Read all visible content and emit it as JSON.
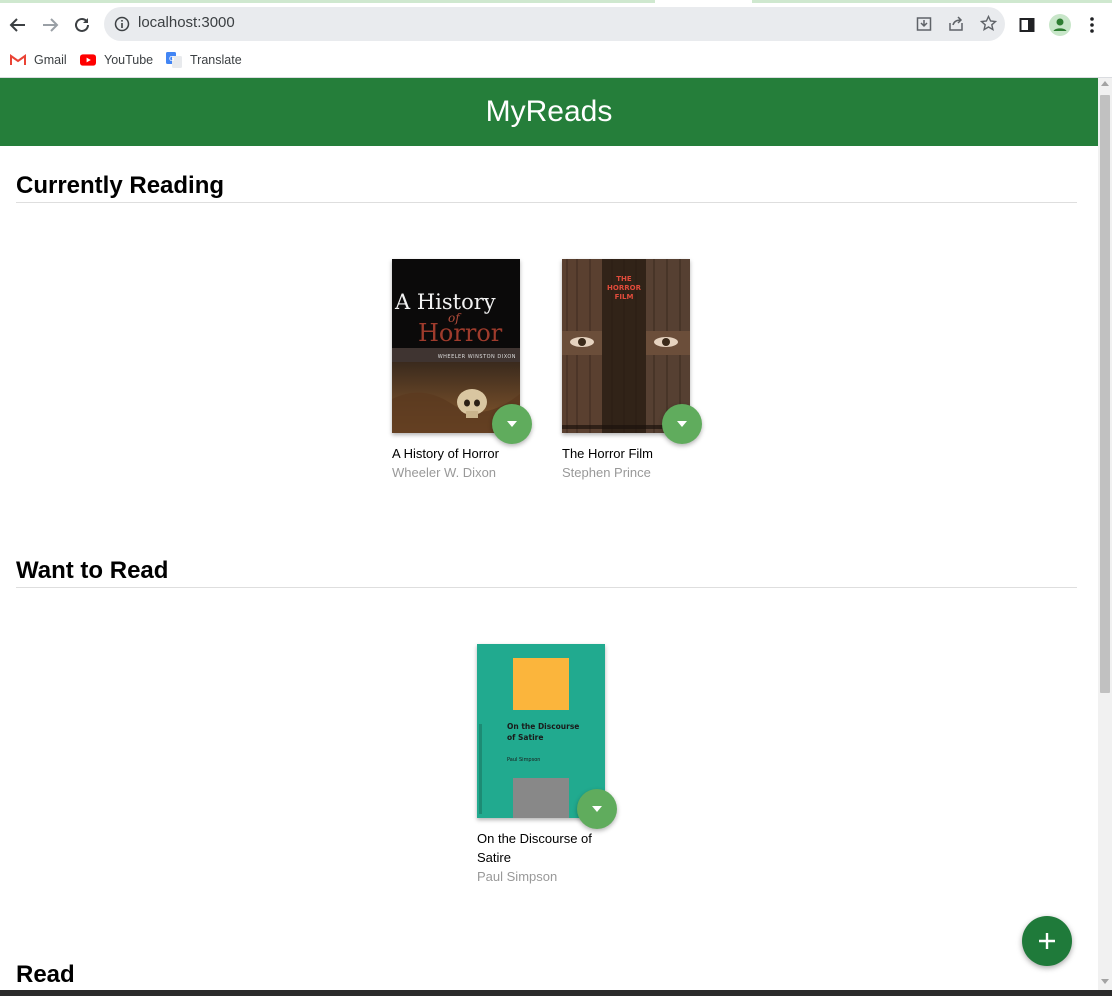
{
  "browser": {
    "url": "localhost:3000",
    "bookmarks": [
      {
        "label": "Gmail",
        "icon": "gmail-icon"
      },
      {
        "label": "YouTube",
        "icon": "youtube-icon"
      },
      {
        "label": "Translate",
        "icon": "translate-icon"
      }
    ]
  },
  "app": {
    "title": "MyReads",
    "shelves": [
      {
        "title": "Currently Reading",
        "books": [
          {
            "title": "A History of Horror",
            "author": "Wheeler W. Dixon",
            "cover_text": {
              "line1": "A History",
              "line2": "of",
              "line3": "Horror",
              "byline": "WHEELER WINSTON DIXON"
            }
          },
          {
            "title": "The Horror Film",
            "author": "Stephen Prince",
            "cover_text": {
              "line1": "THE",
              "line2": "HORROR",
              "line3": "FILM"
            }
          }
        ]
      },
      {
        "title": "Want to Read",
        "books": [
          {
            "title": "On the Discourse of Satire",
            "author": "Paul Simpson",
            "cover_text": {
              "title": "On the Discourse of Satire",
              "author": "Paul Simpson"
            }
          }
        ]
      },
      {
        "title": "Read",
        "books": []
      }
    ]
  },
  "colors": {
    "header": "#257e3a",
    "shelf_changer": "#60ac5d",
    "fab": "#1f7a3a"
  }
}
